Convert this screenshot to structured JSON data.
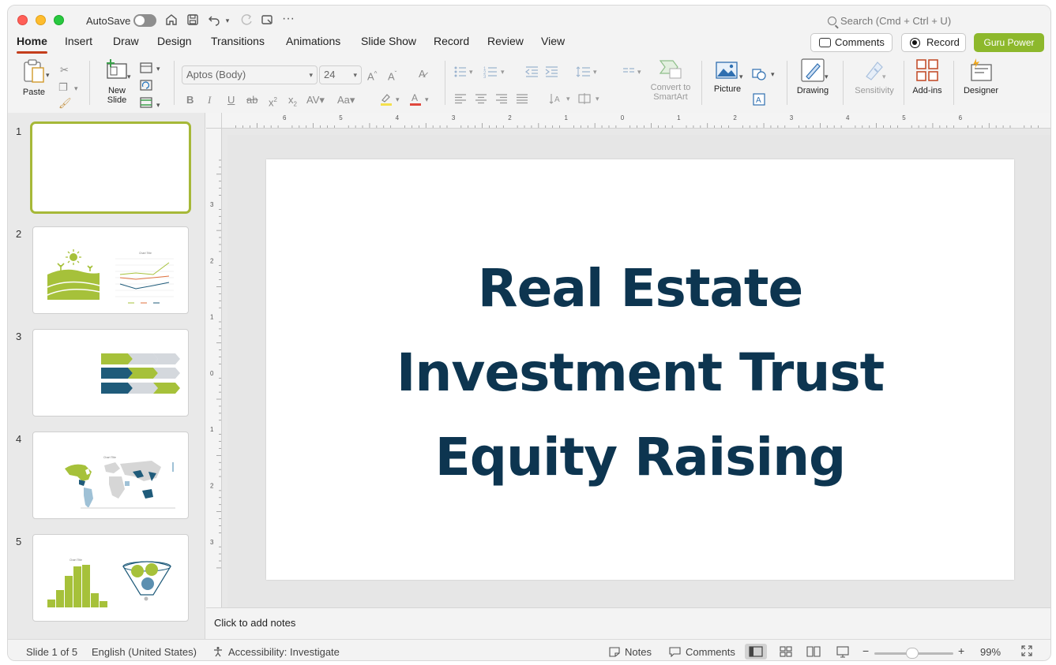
{
  "titlebar": {
    "autosave_label": "AutoSave",
    "search_placeholder": "Search (Cmd + Ctrl + U)"
  },
  "tabs": [
    {
      "label": "Home",
      "active": true
    },
    {
      "label": "Insert"
    },
    {
      "label": "Draw"
    },
    {
      "label": "Design"
    },
    {
      "label": "Transitions"
    },
    {
      "label": "Animations"
    },
    {
      "label": "Slide Show"
    },
    {
      "label": "Record"
    },
    {
      "label": "Review"
    },
    {
      "label": "View"
    }
  ],
  "header_buttons": {
    "comments": "Comments",
    "record": "Record",
    "guru": "Guru Power"
  },
  "ribbon": {
    "paste": "Paste",
    "new_slide": "New\nSlide",
    "font_name": "Aptos (Body)",
    "font_size": "24",
    "convert_smartart": "Convert to\nSmartArt",
    "picture": "Picture",
    "drawing": "Drawing",
    "sensitivity": "Sensitivity",
    "addins": "Add-ins",
    "designer": "Designer"
  },
  "thumbnails": [
    {
      "number": "1",
      "selected": true
    },
    {
      "number": "2"
    },
    {
      "number": "3"
    },
    {
      "number": "4"
    },
    {
      "number": "5"
    }
  ],
  "thumb_texts": {
    "chart_title": "Chart Title"
  },
  "slide": {
    "title_lines": [
      "Real Estate",
      "Investment Trust",
      "Equity Raising"
    ]
  },
  "ruler": {
    "h_labels": [
      "6",
      "5",
      "4",
      "3",
      "2",
      "1",
      "0",
      "1",
      "2",
      "3",
      "4",
      "5",
      "6"
    ],
    "v_labels": [
      "3",
      "2",
      "1",
      "0",
      "1",
      "2",
      "3"
    ]
  },
  "notes_placeholder": "Click to add notes",
  "status": {
    "slide_counter": "Slide 1 of 5",
    "language": "English (United States)",
    "accessibility": "Accessibility: Investigate",
    "notes": "Notes",
    "comments": "Comments",
    "zoom": "99%"
  },
  "colors": {
    "accent_tab": "#c43e1c",
    "guru_button": "#8db82c",
    "title_text": "#0d3550",
    "thumb_green": "#a6c13a",
    "thumb_navy": "#1f5b7a"
  }
}
